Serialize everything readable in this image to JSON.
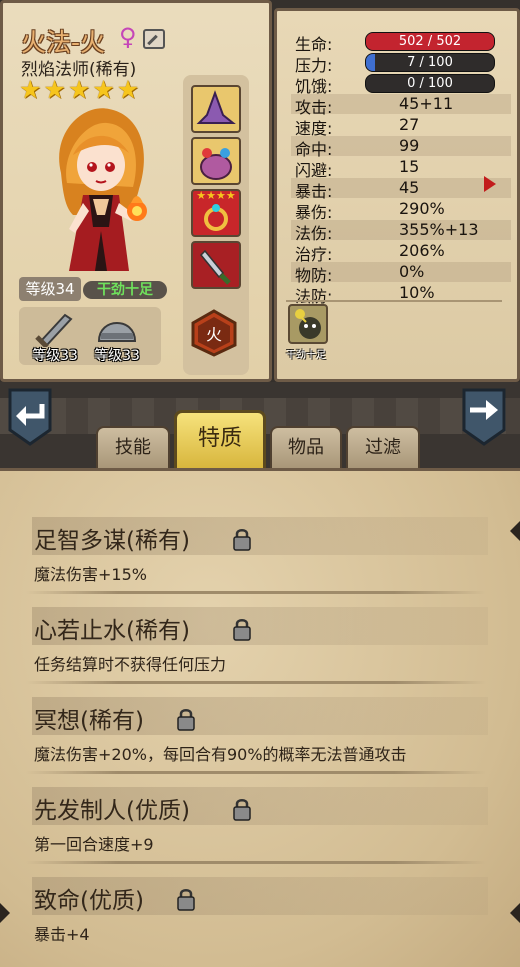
{
  "character": {
    "name": "火法-火",
    "gender_icon": "♀",
    "class_label": "烈焰法师(稀有)",
    "stars": [
      "★",
      "★",
      "★",
      "★",
      "★"
    ],
    "level_label": "等级34",
    "status_label": "干劲十足",
    "equipment": [
      {
        "icon": "sword-icon",
        "level_label": "等级33"
      },
      {
        "icon": "helmet-icon",
        "level_label": "等级33"
      }
    ],
    "item_slots": [
      {
        "icon": "wizard-hat-icon"
      },
      {
        "icon": "potion-bag-icon"
      },
      {
        "icon": "ring-icon",
        "rarity_stars": "★★★★"
      },
      {
        "icon": "dagger-icon"
      }
    ],
    "element_badge": "火"
  },
  "stats": {
    "hp": {
      "label": "生命:",
      "value": "502 / 502",
      "current": 502,
      "max": 502,
      "color": "#c3242f"
    },
    "stress": {
      "label": "压力:",
      "value": "7 / 100",
      "current": 7,
      "max": 100,
      "color": "#3f6fd0"
    },
    "hunger": {
      "label": "饥饿:",
      "value": "0 / 100",
      "current": 0,
      "max": 100,
      "color": "#d08a2c"
    },
    "rows": [
      {
        "label": "攻击:",
        "value": "45+11"
      },
      {
        "label": "速度:",
        "value": "27"
      },
      {
        "label": "命中:",
        "value": "99"
      },
      {
        "label": "闪避:",
        "value": "15"
      },
      {
        "label": "暴击:",
        "value": "45"
      },
      {
        "label": "暴伤:",
        "value": "290%"
      },
      {
        "label": "法伤:",
        "value": "355%+13"
      },
      {
        "label": "治疗:",
        "value": "206%"
      },
      {
        "label": "物防:",
        "value": "0%"
      },
      {
        "label": "法防:",
        "value": "10%"
      }
    ],
    "buff": {
      "icon": "buff-mood-icon",
      "label": "干劲十足"
    }
  },
  "tabs": [
    {
      "label": "技能"
    },
    {
      "label": "特质"
    },
    {
      "label": "物品"
    },
    {
      "label": "过滤"
    }
  ],
  "active_tab": "特质",
  "traits": [
    {
      "title": "足智多谋(稀有)",
      "desc": "魔法伤害+15%"
    },
    {
      "title": "心若止水(稀有)",
      "desc": "任务结算时不获得任何压力"
    },
    {
      "title": "冥想(稀有)",
      "desc": "魔法伤害+20%，每回合有90%的概率无法普通攻击"
    },
    {
      "title": "先发制人(优质)",
      "desc": "第一回合速度+9"
    },
    {
      "title": "致命(优质)",
      "desc": "暴击+4"
    }
  ]
}
